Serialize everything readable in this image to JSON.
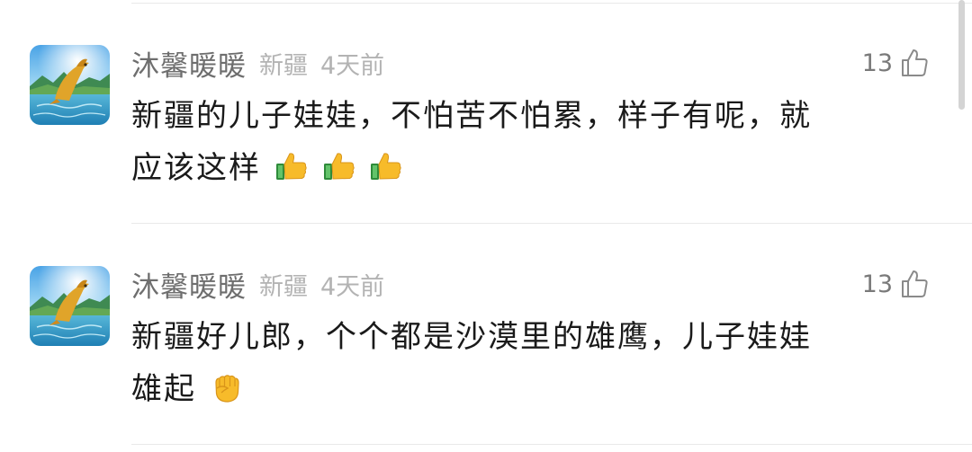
{
  "comments": [
    {
      "username": "沐馨暖暖",
      "location": "新疆",
      "time": "4天前",
      "likes": "13",
      "line1": "新疆的儿子娃娃，不怕苦不怕累，样子有呢，就",
      "line2": "应该这样",
      "emojis": [
        "thumbs-up-icon",
        "thumbs-up-icon",
        "thumbs-up-icon"
      ]
    },
    {
      "username": "沐馨暖暖",
      "location": "新疆",
      "time": "4天前",
      "likes": "13",
      "line1": "新疆好儿郎，个个都是沙漠里的雄鹰，儿子娃娃",
      "line2": "雄起",
      "emojis": [
        "raised-fist-icon"
      ]
    }
  ],
  "colors": {
    "username": "#6e6e6e",
    "meta": "#b3b3b3",
    "text": "#1a1a1a",
    "divider": "#e9e9e9"
  }
}
